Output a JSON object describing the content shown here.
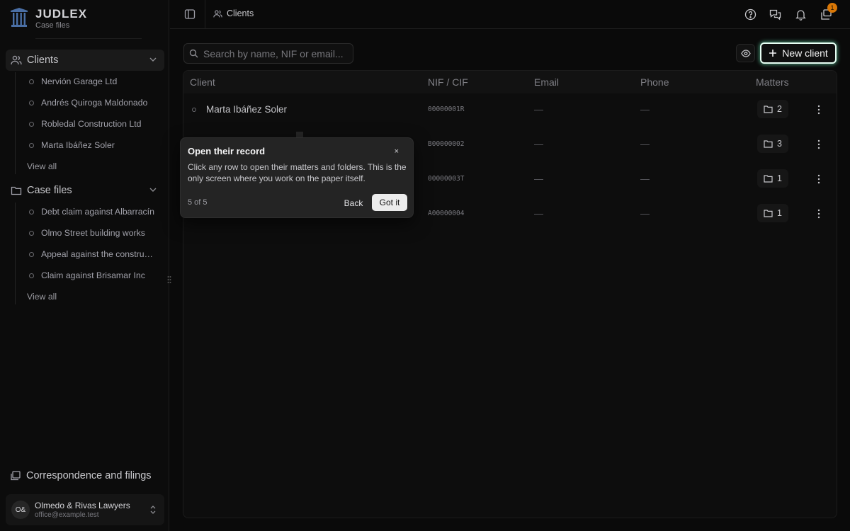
{
  "brand": {
    "name": "JUDLEX",
    "subtitle": "Case files",
    "logo_icon": "pillar-logo"
  },
  "sidebar": {
    "clients": {
      "label": "Clients",
      "items": [
        "Nervión Garage Ltd",
        "Andrés Quiroga Maldonado",
        "Robledal Construction Ltd",
        "Marta Ibáñez Soler"
      ],
      "view_all": "View all"
    },
    "case_files": {
      "label": "Case files",
      "items": [
        "Debt claim against Albarracín",
        "Olmo Street building works",
        "Appeal against the construction",
        "Claim against Brisamar Inc"
      ],
      "view_all": "View all"
    },
    "correspondence": "Correspondence and filings",
    "account": {
      "initials": "O&",
      "org": "Olmedo & Rivas Lawyers",
      "email": "office@example.test"
    }
  },
  "topbar": {
    "breadcrumb": "Clients",
    "inbox_badge": "1"
  },
  "search": {
    "placeholder": "Search by name, NIF or email..."
  },
  "actions": {
    "new_client": "New client"
  },
  "table": {
    "headers": {
      "client": "Client",
      "nif": "NIF / CIF",
      "email": "Email",
      "phone": "Phone",
      "matters": "Matters"
    },
    "rows": [
      {
        "client": "Marta Ibáñez Soler",
        "nif": "00000001R",
        "email": "—",
        "phone": "—",
        "matters": "2"
      },
      {
        "client": "",
        "nif": "B00000002",
        "email": "—",
        "phone": "—",
        "matters": "3"
      },
      {
        "client": "",
        "nif": "00000003T",
        "email": "—",
        "phone": "—",
        "matters": "1"
      },
      {
        "client": "",
        "nif": "A00000004",
        "email": "—",
        "phone": "—",
        "matters": "1"
      }
    ]
  },
  "tour": {
    "title": "Open their record",
    "close": "×",
    "body": "Click any row to open their matters and folders. This is the only screen where you work on the paper itself.",
    "step": "5 of 5",
    "back": "Back",
    "done": "Got it"
  },
  "colors": {
    "accent_glow": "#78ffc8",
    "badge": "#d97706",
    "background": "#0a0a0a"
  }
}
